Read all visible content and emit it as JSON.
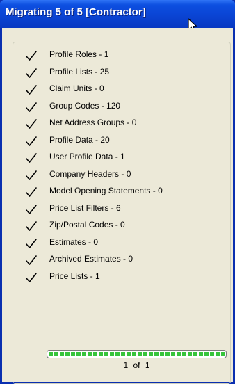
{
  "window": {
    "title": "Migrating 5 of 5 [Contractor]"
  },
  "tasks": [
    {
      "label": "Profile Roles - 1",
      "status": "done"
    },
    {
      "label": "Profile Lists - 25",
      "status": "done"
    },
    {
      "label": "Claim Units - 0",
      "status": "done"
    },
    {
      "label": "Group Codes - 120",
      "status": "done"
    },
    {
      "label": "Net Address Groups - 0",
      "status": "done"
    },
    {
      "label": "Profile Data - 20",
      "status": "done"
    },
    {
      "label": "User Profile Data - 1",
      "status": "done"
    },
    {
      "label": "Company Headers - 0",
      "status": "done"
    },
    {
      "label": "Model Opening Statements - 0",
      "status": "done"
    },
    {
      "label": "Price List Filters - 6",
      "status": "done"
    },
    {
      "label": "Zip/Postal Codes - 0",
      "status": "done"
    },
    {
      "label": "Estimates - 0",
      "status": "done"
    },
    {
      "label": "Archived Estimates - 0",
      "status": "done"
    },
    {
      "label": "Price Lists - 1",
      "status": "done"
    }
  ],
  "progress": {
    "value": 1.0,
    "counter": "1  of  1"
  },
  "icons": {
    "task_status": "checkmark-icon",
    "cursor": "mouse-pointer-icon"
  },
  "colors": {
    "titlebar": "#0a44d4",
    "window_body": "#ece9d8",
    "progress_fill": "#37c43b"
  }
}
